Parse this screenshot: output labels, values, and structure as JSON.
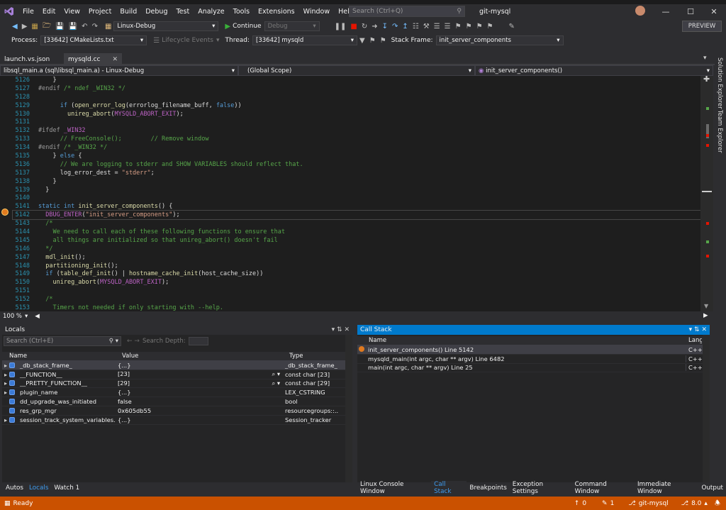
{
  "title_bar": {
    "menu": [
      "File",
      "Edit",
      "View",
      "Project",
      "Build",
      "Debug",
      "Test",
      "Analyze",
      "Tools",
      "Extensions",
      "Window",
      "Help"
    ],
    "search_placeholder": "Search (Ctrl+Q)",
    "solution": "git-mysql"
  },
  "toolbar": {
    "config": "Linux-Debug",
    "continue": "Continue",
    "debug_target": "Debug",
    "preview": "PREVIEW"
  },
  "debug_location": {
    "process_label": "Process:",
    "process": "[33642] CMakeLists.txt",
    "lifecycle": "Lifecycle Events",
    "thread_label": "Thread:",
    "thread": "[33642] mysqld",
    "stack_frame_label": "Stack Frame:",
    "stack_frame": "init_server_components"
  },
  "tabs": [
    "launch.vs.json",
    "mysqld.cc"
  ],
  "nav": {
    "project": "libsql_main.a (sql\\libsql_main.a) - Linux-Debug",
    "scope": "(Global Scope)",
    "member": "init_server_components()"
  },
  "code_lines": [
    {
      "n": "5126",
      "t": "    }"
    },
    {
      "n": "5127",
      "t": "#endif /* ndef _WIN32 */"
    },
    {
      "n": "5128",
      "t": ""
    },
    {
      "n": "5129",
      "t": "      if (open_error_log(errorlog_filename_buff, false))"
    },
    {
      "n": "5130",
      "t": "        unireg_abort(MYSQLD_ABORT_EXIT);"
    },
    {
      "n": "5131",
      "t": ""
    },
    {
      "n": "5132",
      "t": "#ifdef _WIN32"
    },
    {
      "n": "5133",
      "t": "      // FreeConsole();        // Remove window"
    },
    {
      "n": "5134",
      "t": "#endif /* _WIN32 */"
    },
    {
      "n": "5135",
      "t": "    } else {"
    },
    {
      "n": "5136",
      "t": "      // We are logging to stderr and SHOW VARIABLES should reflect that."
    },
    {
      "n": "5137",
      "t": "      log_error_dest = \"stderr\";"
    },
    {
      "n": "5138",
      "t": "    }"
    },
    {
      "n": "5139",
      "t": "  }"
    },
    {
      "n": "5140",
      "t": ""
    },
    {
      "n": "5141",
      "t": "static int init_server_components() {"
    },
    {
      "n": "5142",
      "t": "  DBUG_ENTER(\"init_server_components\");"
    },
    {
      "n": "5143",
      "t": "  /*"
    },
    {
      "n": "5144",
      "t": "    We need to call each of these following functions to ensure that"
    },
    {
      "n": "5145",
      "t": "    all things are initialized so that unireg_abort() doesn't fail"
    },
    {
      "n": "5146",
      "t": "  */"
    },
    {
      "n": "5147",
      "t": "  mdl_init();"
    },
    {
      "n": "5148",
      "t": "  partitioning_init();"
    },
    {
      "n": "5149",
      "t": "  if (table_def_init() | hostname_cache_init(host_cache_size))"
    },
    {
      "n": "5150",
      "t": "    unireg_abort(MYSQLD_ABORT_EXIT);"
    },
    {
      "n": "5151",
      "t": ""
    },
    {
      "n": "5152",
      "t": "  /*"
    },
    {
      "n": "5153",
      "t": "    Timers not needed if only starting with --help."
    }
  ],
  "zoom": "100 %",
  "locals": {
    "title": "Locals",
    "search_placeholder": "Search (Ctrl+E)",
    "search_depth": "Search Depth:",
    "columns": [
      "Name",
      "Value",
      "Type"
    ],
    "rows": [
      {
        "name": "_db_stack_frame_",
        "value": "{...}",
        "type": "_db_stack_frame_"
      },
      {
        "name": "__FUNCTION__",
        "value": "[23]",
        "type": "const char [23]"
      },
      {
        "name": "__PRETTY_FUNCTION__",
        "value": "[29]",
        "type": "const char [29]"
      },
      {
        "name": "plugin_name",
        "value": "{...}",
        "type": "LEX_CSTRING"
      },
      {
        "name": "dd_upgrade_was_initiated",
        "value": "false",
        "type": "bool"
      },
      {
        "name": "res_grp_mgr",
        "value": "0x605db55",
        "type": "resourcegroups::..."
      },
      {
        "name": "session_track_system_variables...",
        "value": "{...}",
        "type": "Session_tracker"
      }
    ]
  },
  "call_stack": {
    "title": "Call Stack",
    "columns": [
      "Name",
      "Lang"
    ],
    "rows": [
      {
        "name": "init_server_components() Line 5142",
        "lang": "C++"
      },
      {
        "name": "mysqld_main(int argc, char ** argv) Line 6482",
        "lang": "C++"
      },
      {
        "name": "main(int argc, char ** argv) Line 25",
        "lang": "C++"
      }
    ]
  },
  "bottom_tabs_left": [
    "Autos",
    "Locals",
    "Watch 1"
  ],
  "bottom_tabs_right": [
    "Linux Console Window",
    "Call Stack",
    "Breakpoints",
    "Exception Settings",
    "Command Window",
    "Immediate Window",
    "Output"
  ],
  "side_tabs": [
    "Solution Explorer",
    "Team Explorer"
  ],
  "status": {
    "ready": "Ready",
    "up": "0",
    "pencil": "1",
    "branch": "git-mysql",
    "version": "8.0"
  },
  "colors": {
    "accent": "#007acc",
    "status_bar": "#ca5100"
  }
}
